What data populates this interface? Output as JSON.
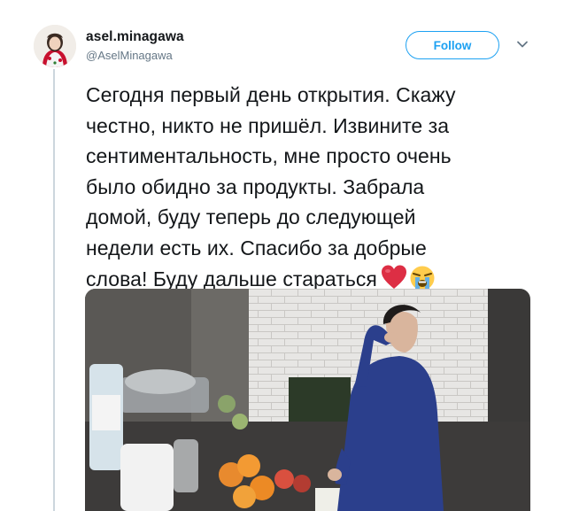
{
  "tweet": {
    "display_name": "asel.minagawa",
    "handle": "@AselMinagawa",
    "follow_label": "Follow",
    "text": "Сегодня первый день открытия. Скажу\nчестно, никто не пришёл. Извините за\nсентиментальность, мне просто очень\nбыло обидно за продукты. Забрала\nдомой, буду теперь до следующей\nнедели есть их. Спасибо за добрые\nслова! Буду дальше стараться",
    "emojis": [
      "red-heart-icon",
      "loudly-crying-face-icon"
    ]
  },
  "colors": {
    "accent": "#1da1f2",
    "text": "#14171a",
    "secondary_text": "#657786",
    "thread_line": "#ccd6dd"
  }
}
